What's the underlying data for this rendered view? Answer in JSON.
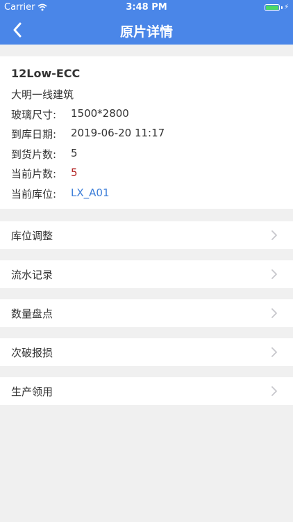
{
  "status_bar": {
    "carrier": "Carrier",
    "time": "3:48 PM"
  },
  "nav": {
    "title": "原片详情",
    "back_icon": "chevron-left-icon"
  },
  "glass": {
    "title": "12Low-ECC",
    "company": "大明一线建筑",
    "size_label": "玻璃尺寸:",
    "size_value": "1500*2800",
    "arrival_date_label": "到库日期:",
    "arrival_date_value": "2019-06-20 11:17",
    "received_count_label": "到货片数:",
    "received_count_value": "5",
    "current_count_label": "当前片数:",
    "current_count_value": "5",
    "location_label": "当前库位:",
    "location_value": "LX_A01"
  },
  "menu": {
    "items": [
      {
        "label": "库位调整"
      },
      {
        "label": "流水记录"
      },
      {
        "label": "数量盘点"
      },
      {
        "label": "次破报损"
      },
      {
        "label": "生产领用"
      }
    ]
  },
  "colors": {
    "header": "#4a86e8",
    "background": "#f0f0f0",
    "current_count": "#b22222",
    "location": "#3b7dd8",
    "battery": "#4cd964"
  }
}
